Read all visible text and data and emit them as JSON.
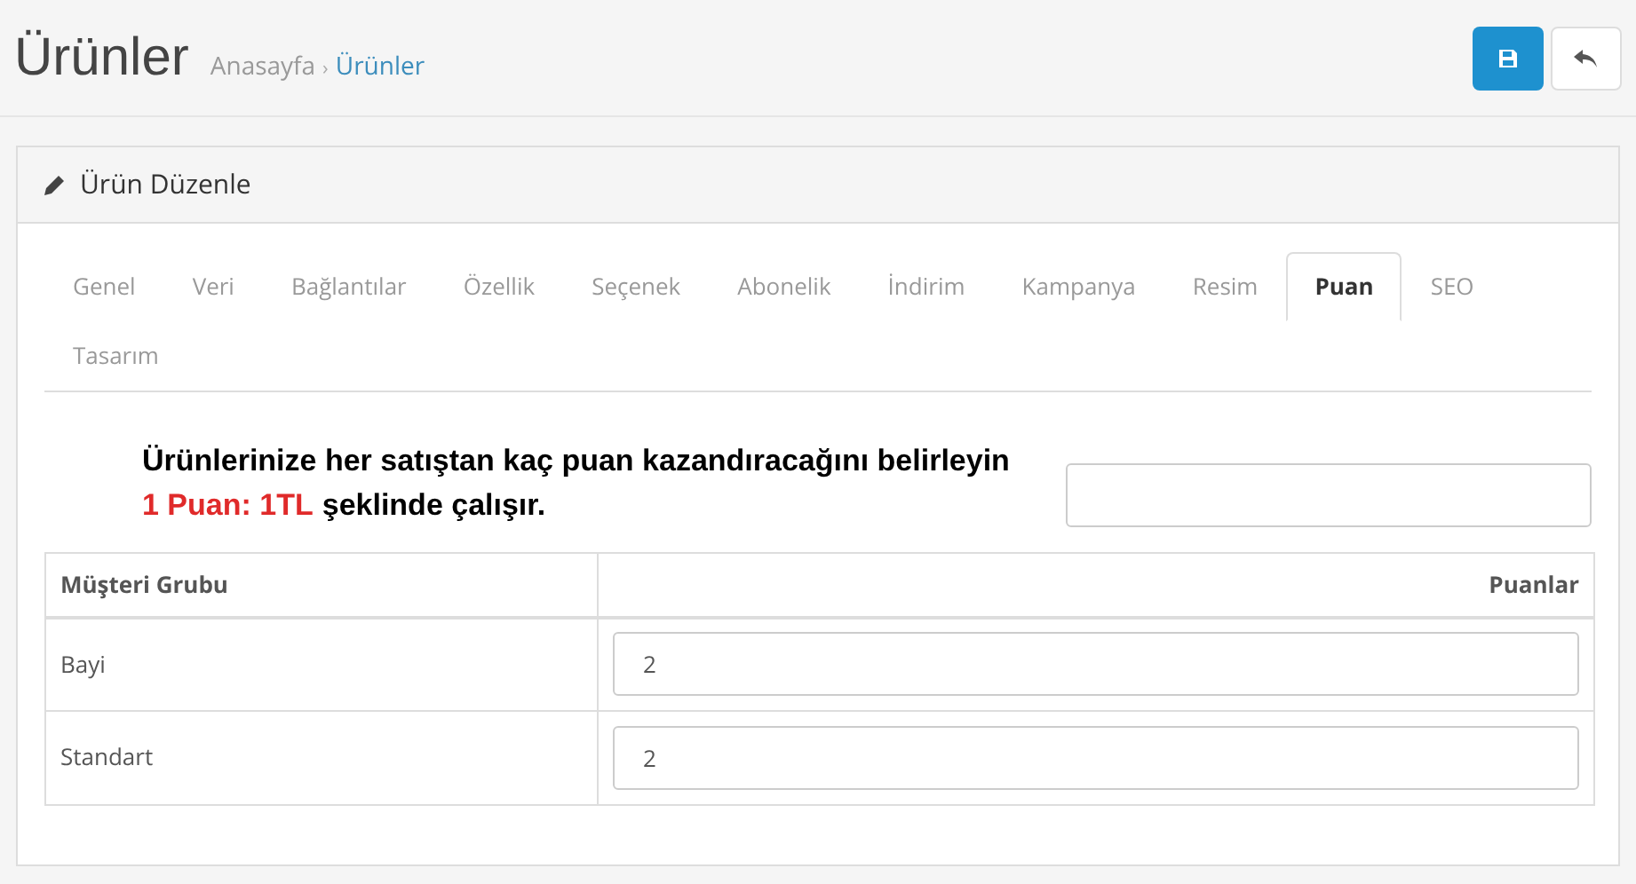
{
  "page": {
    "title": "Ürünler"
  },
  "breadcrumb": [
    {
      "label": "Anasayfa",
      "selected": false
    },
    {
      "label": "Ürünler",
      "selected": true
    }
  ],
  "separator": "›",
  "panel": {
    "title": "Ürün Düzenle"
  },
  "tabs": [
    {
      "label": "Genel",
      "selected": false
    },
    {
      "label": "Veri",
      "selected": false
    },
    {
      "label": "Bağlantılar",
      "selected": false
    },
    {
      "label": "Özellik",
      "selected": false
    },
    {
      "label": "Seçenek",
      "selected": false
    },
    {
      "label": "Abonelik",
      "selected": false
    },
    {
      "label": "İndirim",
      "selected": false
    },
    {
      "label": "Kampanya",
      "selected": false
    },
    {
      "label": "Resim",
      "selected": false
    },
    {
      "label": "Puan",
      "selected": true
    },
    {
      "label": "SEO",
      "selected": false
    },
    {
      "label": "Tasarım",
      "selected": false
    }
  ],
  "note": {
    "line_1": "Ürünlerinize her satıştan kaç puan kazandıracağını belirleyin",
    "highlight": "1 Puan: 1TL",
    "line_2": "şeklinde çalışır."
  },
  "table": {
    "columns": [
      "Müşteri Grubu",
      "Puanlar"
    ],
    "rows": [
      {
        "group": "Bayi",
        "points": "2"
      },
      {
        "group": "Standart",
        "points": "2"
      }
    ]
  }
}
